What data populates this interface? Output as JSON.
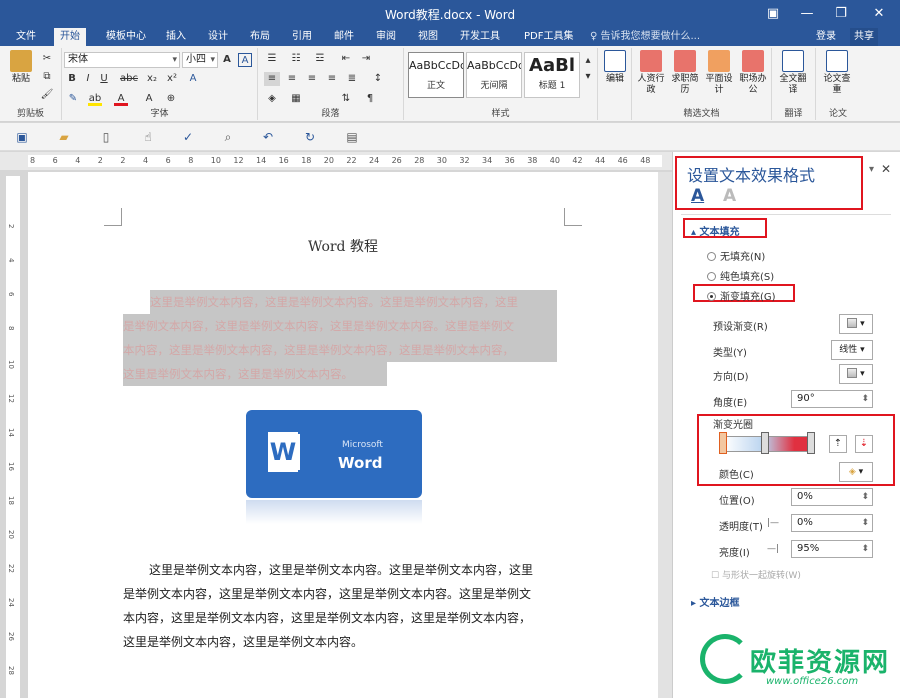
{
  "window": {
    "title": "Word教程.docx - Word",
    "min": "—",
    "restore": "❐",
    "close": "✕",
    "ribbon_toggle": "▣"
  },
  "tabs": [
    "文件",
    "开始",
    "模板中心",
    "插入",
    "设计",
    "布局",
    "引用",
    "邮件",
    "审阅",
    "视图",
    "开发工具",
    "PDF工具集"
  ],
  "active_tab": "开始",
  "tell_me": "♀ 告诉我您想要做什么...",
  "login": "登录",
  "share": "共享",
  "ribbon": {
    "clipboard": {
      "paste": "粘贴",
      "label": "剪贴板"
    },
    "font": {
      "name": "宋体",
      "size": "小四",
      "label": "字体",
      "buttons": [
        "B",
        "I",
        "U",
        "abc",
        "x₂",
        "x²",
        "A"
      ]
    },
    "paragraph": {
      "label": "段落"
    },
    "styles": {
      "label": "样式",
      "items": [
        {
          "preview": "AaBbCcDd",
          "name": "正文"
        },
        {
          "preview": "AaBbCcDd",
          "name": "无间隔"
        },
        {
          "preview": "AaBl",
          "name": "标题 1"
        }
      ]
    },
    "edit": {
      "label": "编辑"
    },
    "templates": {
      "label": "精选文档",
      "items": [
        "人资行政",
        "求职简历",
        "平面设计",
        "职场办公"
      ]
    },
    "translate": {
      "label": "翻译",
      "item": "全文翻译"
    },
    "paper": {
      "label": "论文",
      "item": "论文查重"
    }
  },
  "document": {
    "title": "Word 教程",
    "highlighted_lines": [
      "这里是举例文本内容，这里是举例文本内容。这里是举例文本内容，这里",
      "是举例文本内容，这里是举例文本内容，这里是举例文本内容。这里是举例文",
      "本内容，这里是举例文本内容，这里是举例文本内容，这里是举例文本内容，",
      "这里是举例文本内容，这里是举例文本内容。"
    ],
    "logo": {
      "microsoft": "Microsoft",
      "word": "Word",
      "w": "W"
    },
    "body_lines": [
      "这里是举例文本内容，这里是举例文本内容。这里是举例文本内容，这里",
      "是举例文本内容，这里是举例文本内容，这里是举例文本内容。这里是举例文",
      "本内容，这里是举例文本内容，这里是举例文本内容，这里是举例文本内容，",
      "这里是举例文本内容，这里是举例文本内容。"
    ]
  },
  "ruler": {
    "h": [
      "8",
      "6",
      "4",
      "2",
      "2",
      "4",
      "6",
      "8",
      "10",
      "12",
      "14",
      "16",
      "18",
      "20",
      "22",
      "24",
      "26",
      "28",
      "30",
      "32",
      "34",
      "36",
      "38",
      "40",
      "42",
      "44",
      "46",
      "48"
    ],
    "v": [
      "2",
      "4",
      "6",
      "8",
      "10",
      "12",
      "14",
      "16",
      "18",
      "20",
      "22",
      "24",
      "26",
      "28"
    ]
  },
  "pane": {
    "title": "设置文本效果格式",
    "fill_section": "文本填充",
    "options": [
      "无填充(N)",
      "纯色填充(S)",
      "渐变填充(G)"
    ],
    "selected_option": "渐变填充(G)",
    "preset": "预设渐变(R)",
    "type_label": "类型(Y)",
    "type_value": "线性",
    "direction": "方向(D)",
    "angle_label": "角度(E)",
    "angle_value": "90°",
    "stops_label": "渐变光圈",
    "color_label": "颜色(C)",
    "position_label": "位置(O)",
    "position_value": "0%",
    "transparency_label": "透明度(T)",
    "transparency_value": "0%",
    "brightness_label": "亮度(I)",
    "brightness_value": "95%",
    "rotate_with_shape": "与形状一起旋转(W)",
    "border_section": "文本边框",
    "close": "✕",
    "menu": "▾"
  },
  "watermark": {
    "text": "欧菲资源网",
    "url": "www.office26.com"
  },
  "colors": {
    "accent": "#2b579a",
    "highlight_box": "#e0151f",
    "watermark": "#1ab36b"
  }
}
